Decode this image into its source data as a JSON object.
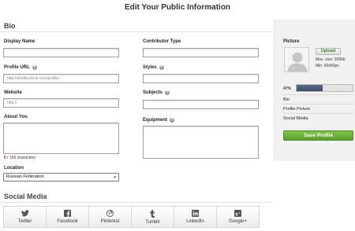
{
  "page": {
    "title": "Edit Your Public Information"
  },
  "bio": {
    "section_title": "Bio",
    "display_name_label": "Display Name",
    "profile_url_label": "Profile URL",
    "profile_url_placeholder": "http://shutterstock.com/profile/",
    "website_label": "Website",
    "website_placeholder": "http://",
    "about_you_label": "About You",
    "char_count": "0",
    "char_limit_text": "/ 150 characters",
    "location_label": "Location",
    "location_value": "Russian Federation",
    "contributor_type_label": "Contributor Type",
    "styles_label": "Styles",
    "subjects_label": "Subjects",
    "equipment_label": "Equipment"
  },
  "sidebar": {
    "picture_label": "Picture",
    "upload_label": "Upload",
    "max_size": "Max. size: 500kb",
    "min_size": "Min. 60x60px",
    "progress_pct": "47%",
    "progress_value": 0.47,
    "checklist": [
      "Bio",
      "Profile Picture",
      "Social Media"
    ],
    "save_label": "Save Profile"
  },
  "social": {
    "section_title": "Social Media",
    "items": [
      {
        "label": "Twitter",
        "icon": "twitter-icon"
      },
      {
        "label": "Facebook",
        "icon": "facebook-icon"
      },
      {
        "label": "Pinterest",
        "icon": "pinterest-icon"
      },
      {
        "label": "Tumblr",
        "icon": "tumblr-icon"
      },
      {
        "label": "LinkedIn",
        "icon": "linkedin-icon"
      },
      {
        "label": "Google+",
        "icon": "google-plus-icon"
      }
    ]
  },
  "colors": {
    "accent_green": "#5aa12a",
    "progress_fill": "#3b4d66",
    "counter_red": "#cc2200"
  }
}
